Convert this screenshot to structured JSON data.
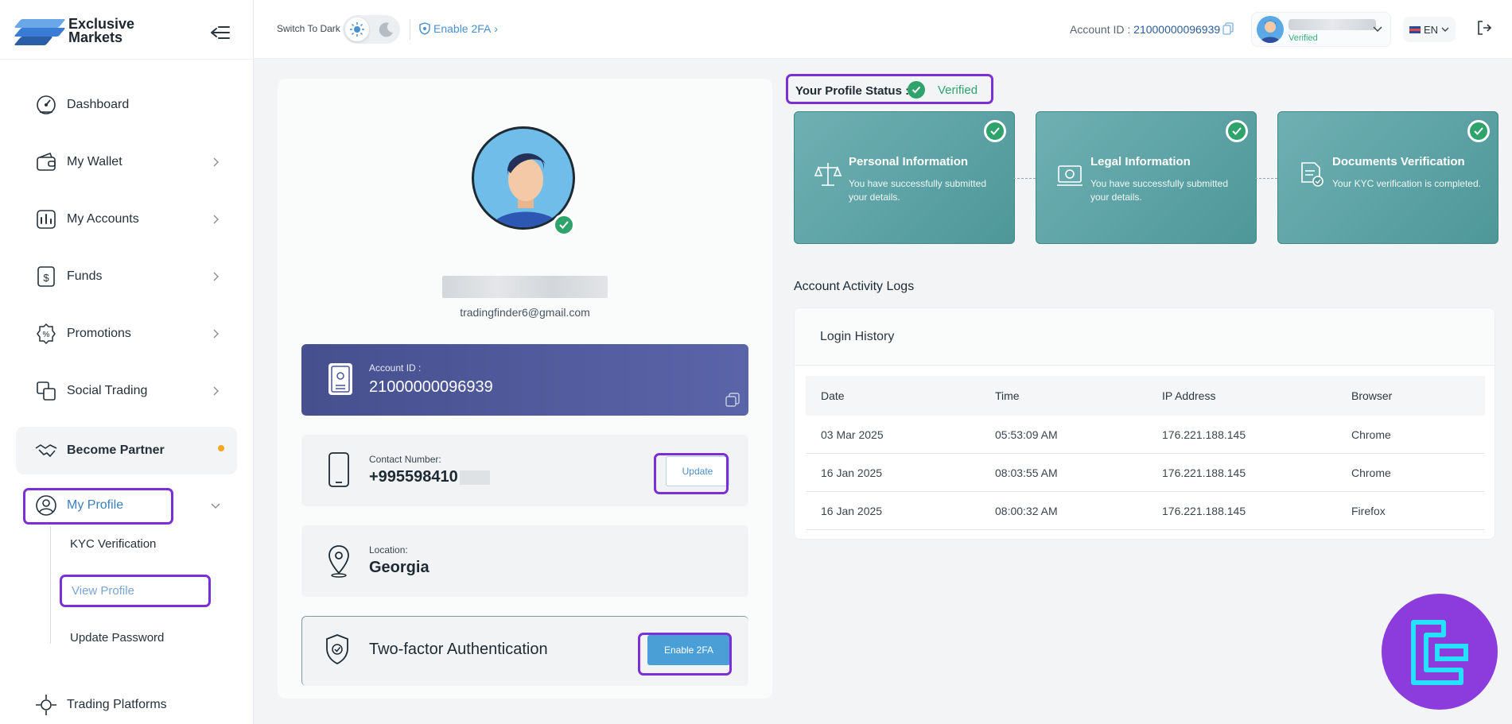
{
  "brand": {
    "line1": "Exclusive",
    "line2": "Markets"
  },
  "topbar": {
    "dark_label": "Switch To Dark",
    "enable_2fa": "Enable 2FA",
    "account_id_label": "Account ID :",
    "account_id_value": "21000000096939",
    "user_status": "Verified",
    "language": "EN"
  },
  "sidebar": {
    "items": [
      {
        "label": "Dashboard",
        "icon": "dashboard-icon"
      },
      {
        "label": "My Wallet",
        "icon": "wallet-icon"
      },
      {
        "label": "My Accounts",
        "icon": "accounts-icon"
      },
      {
        "label": "Funds",
        "icon": "funds-icon"
      },
      {
        "label": "Promotions",
        "icon": "promotions-icon"
      },
      {
        "label": "Social Trading",
        "icon": "social-trading-icon"
      },
      {
        "label": "Become Partner",
        "icon": "handshake-icon"
      },
      {
        "label": "My Profile",
        "icon": "user-circle-icon"
      },
      {
        "label": "Trading Platforms",
        "icon": "platform-icon"
      }
    ],
    "profile_sub": [
      "KYC Verification",
      "View Profile",
      "Update Password"
    ]
  },
  "profile": {
    "email": "tradingfinder6@gmail.com",
    "account_id_label": "Account ID :",
    "account_id_value": "21000000096939",
    "contact_label": "Contact Number:",
    "contact_value": "+995598410",
    "update_label": "Update",
    "location_label": "Location:",
    "location_value": "Georgia",
    "twofa_title": "Two-factor Authentication",
    "twofa_button": "Enable 2FA"
  },
  "status": {
    "label": "Your Profile Status :",
    "value": "Verified",
    "steps": [
      {
        "title": "Personal Information",
        "desc": "You have successfully submitted your details."
      },
      {
        "title": "Legal Information",
        "desc": "You have successfully submitted your details."
      },
      {
        "title": "Documents Verification",
        "desc": "Your KYC verification is completed."
      }
    ]
  },
  "logs": {
    "section_title": "Account Activity Logs",
    "card_title": "Login History",
    "columns": [
      "Date",
      "Time",
      "IP Address",
      "Browser"
    ],
    "rows": [
      [
        "03 Mar 2025",
        "05:53:09 AM",
        "176.221.188.145",
        "Chrome"
      ],
      [
        "16 Jan 2025",
        "08:03:55 AM",
        "176.221.188.145",
        "Chrome"
      ],
      [
        "16 Jan 2025",
        "08:00:32 AM",
        "176.221.188.145",
        "Firefox"
      ]
    ]
  },
  "colors": {
    "accent": "#4a8fd0",
    "verified": "#2fa36b",
    "highlight": "#7b2fd6",
    "teal": "#5aa3a5"
  }
}
